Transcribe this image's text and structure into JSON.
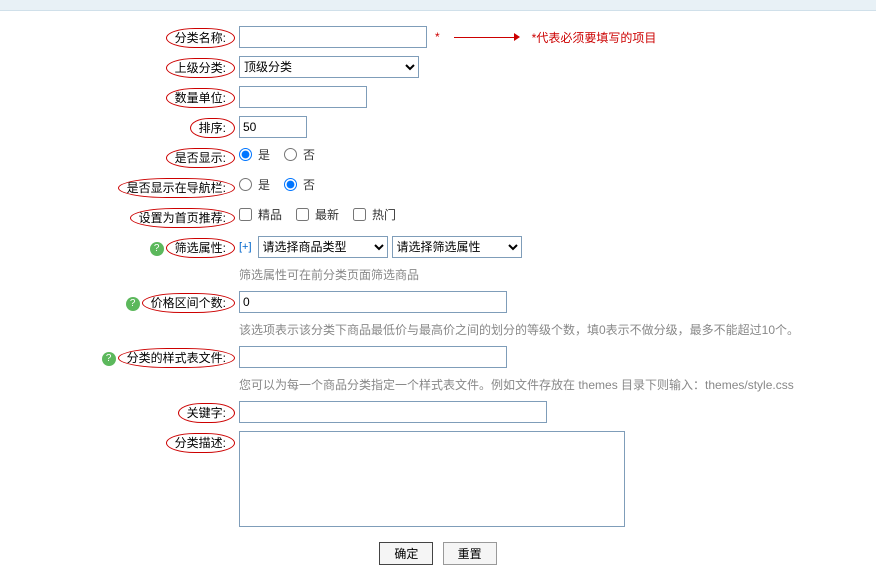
{
  "labels": {
    "name": "分类名称:",
    "parent": "上级分类:",
    "unit": "数量单位:",
    "sort": "排序:",
    "show": "是否显示:",
    "nav": "是否显示在导航栏:",
    "home": "设置为首页推荐:",
    "filter": "筛选属性:",
    "price": "价格区间个数:",
    "style": "分类的样式表文件:",
    "keyword": "关键字:",
    "desc": "分类描述:"
  },
  "values": {
    "name": "",
    "parent_selected": "顶级分类",
    "unit": "",
    "sort": "50",
    "show": "是",
    "nav": "否",
    "price": "0",
    "style": "",
    "keyword": "",
    "desc": ""
  },
  "options": {
    "yes": "是",
    "no": "否",
    "home_boutique": "精品",
    "home_new": "最新",
    "home_hot": "热门",
    "filter_type_ph": "请选择商品类型",
    "filter_attr_ph": "请选择筛选属性",
    "plus": "[+]"
  },
  "hints": {
    "req_note": "*代表必须要填写的项目",
    "req_star": "*",
    "filter": "筛选属性可在前分类页面筛选商品",
    "price": "该选项表示该分类下商品最低价与最高价之间的划分的等级个数，填0表示不做分级，最多不能超过10个。",
    "style": "您可以为每一个商品分类指定一个样式表文件。例如文件存放在 themes 目录下则输入：themes/style.css"
  },
  "buttons": {
    "ok": "确定",
    "reset": "重置"
  }
}
